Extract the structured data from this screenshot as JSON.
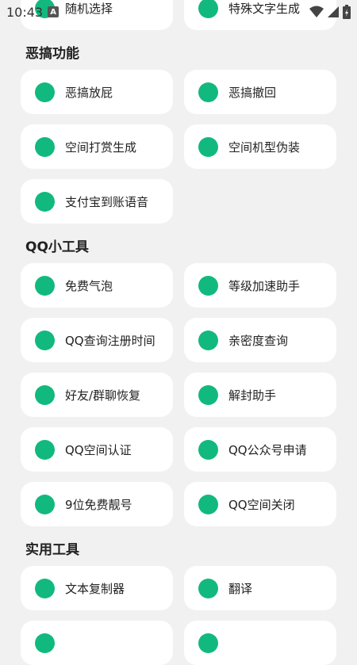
{
  "status_bar": {
    "time": "10:43",
    "app_icon_letter": "A"
  },
  "top_partial": [
    {
      "label": "随机选择"
    },
    {
      "label": "特殊文字生成"
    }
  ],
  "sections": [
    {
      "title": "恶搞功能",
      "items": [
        "恶搞放屁",
        "恶搞撤回",
        "空间打赏生成",
        "空间机型伪装",
        "支付宝到账语音"
      ]
    },
    {
      "title": "QQ小工具",
      "items": [
        "免费气泡",
        "等级加速助手",
        "QQ查询注册时间",
        "亲密度查询",
        "好友/群聊恢复",
        "解封助手",
        "QQ空间认证",
        "QQ公众号申请",
        "9位免费靓号",
        "QQ空间关闭"
      ]
    },
    {
      "title": "实用工具",
      "items": [
        "文本复制器",
        "翻译",
        "",
        ""
      ]
    }
  ],
  "colors": {
    "accent": "#12b97e",
    "background": "#f1f1f1",
    "card": "#ffffff"
  }
}
